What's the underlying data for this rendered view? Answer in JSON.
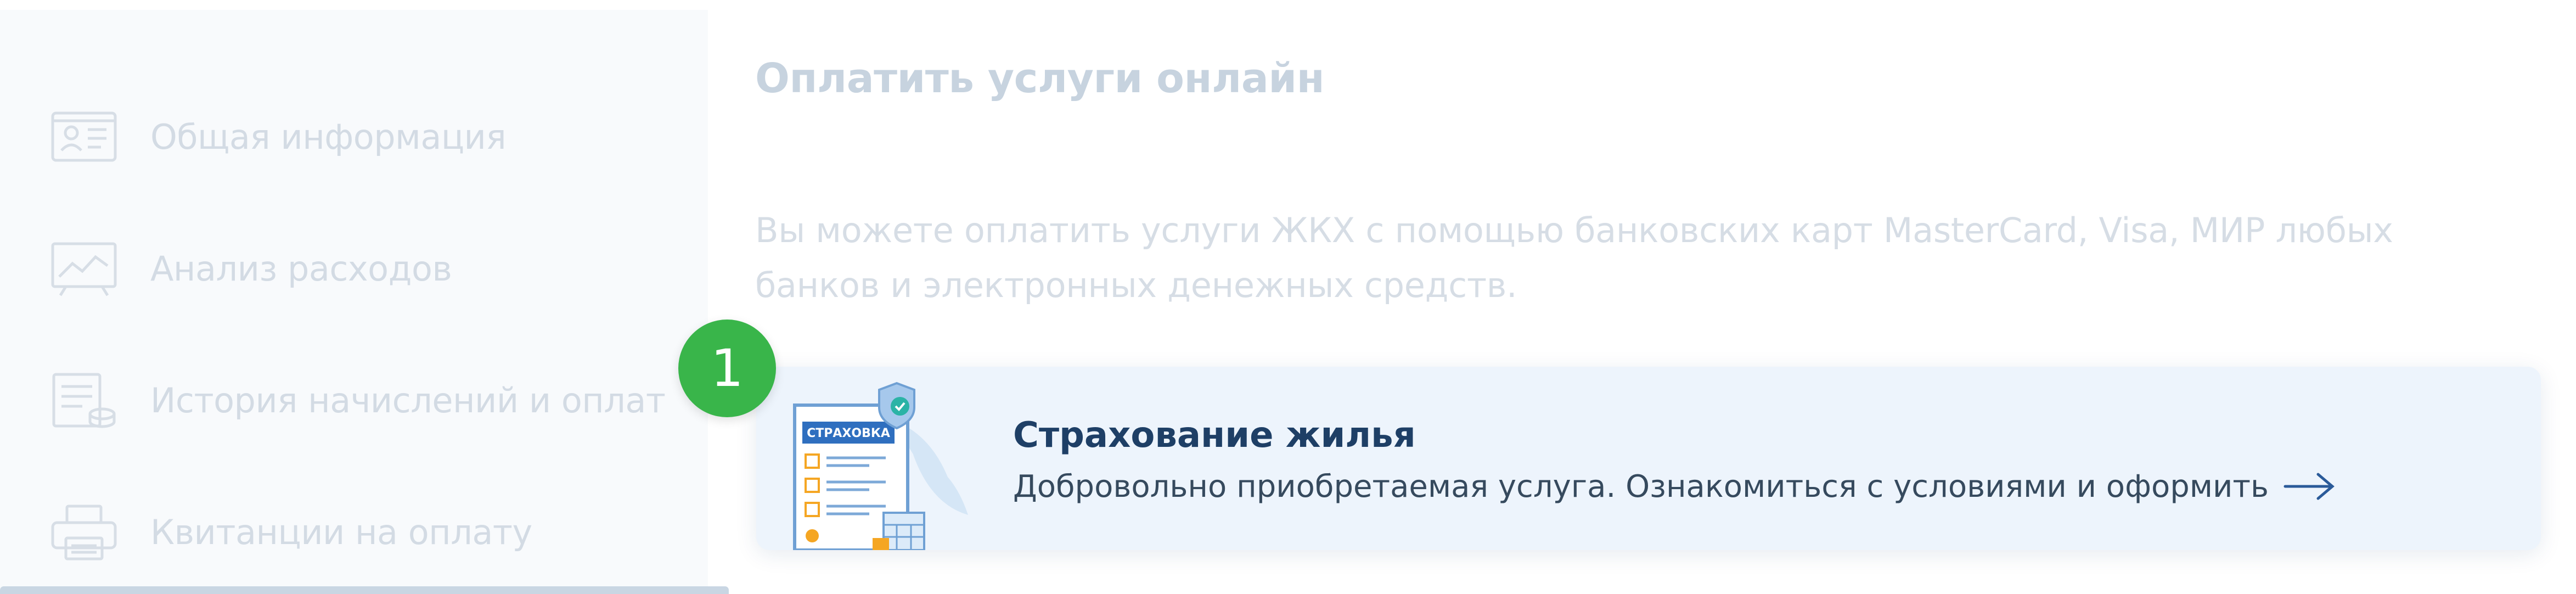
{
  "sidebar": {
    "items": [
      {
        "label": "Общая информация",
        "icon": "id-card-icon"
      },
      {
        "label": "Анализ расходов",
        "icon": "chart-board-icon"
      },
      {
        "label": "История начислений и оплат",
        "icon": "history-icon"
      },
      {
        "label": "Квитанции на оплату",
        "icon": "printer-icon"
      }
    ]
  },
  "main": {
    "title": "Оплатить услуги онлайн",
    "description": "Вы можете оплатить услуги ЖКХ с помощью банковских карт MasterCard, Visa, МИР любых банков и электронных денежных средств.",
    "step_badge": "1",
    "promo": {
      "illustration_label": "СТРАХОВКА",
      "title": "Страхование жилья",
      "text": "Добровольно приобретаемая услуга. Ознакомиться с условиями и оформить",
      "arrow_icon": "arrow-right-icon"
    }
  },
  "colors": {
    "badge": "#39b54a",
    "promo_title": "#1e3f66",
    "promo_bg": "#edf4fc",
    "faded_text": "#d3dbe4"
  }
}
